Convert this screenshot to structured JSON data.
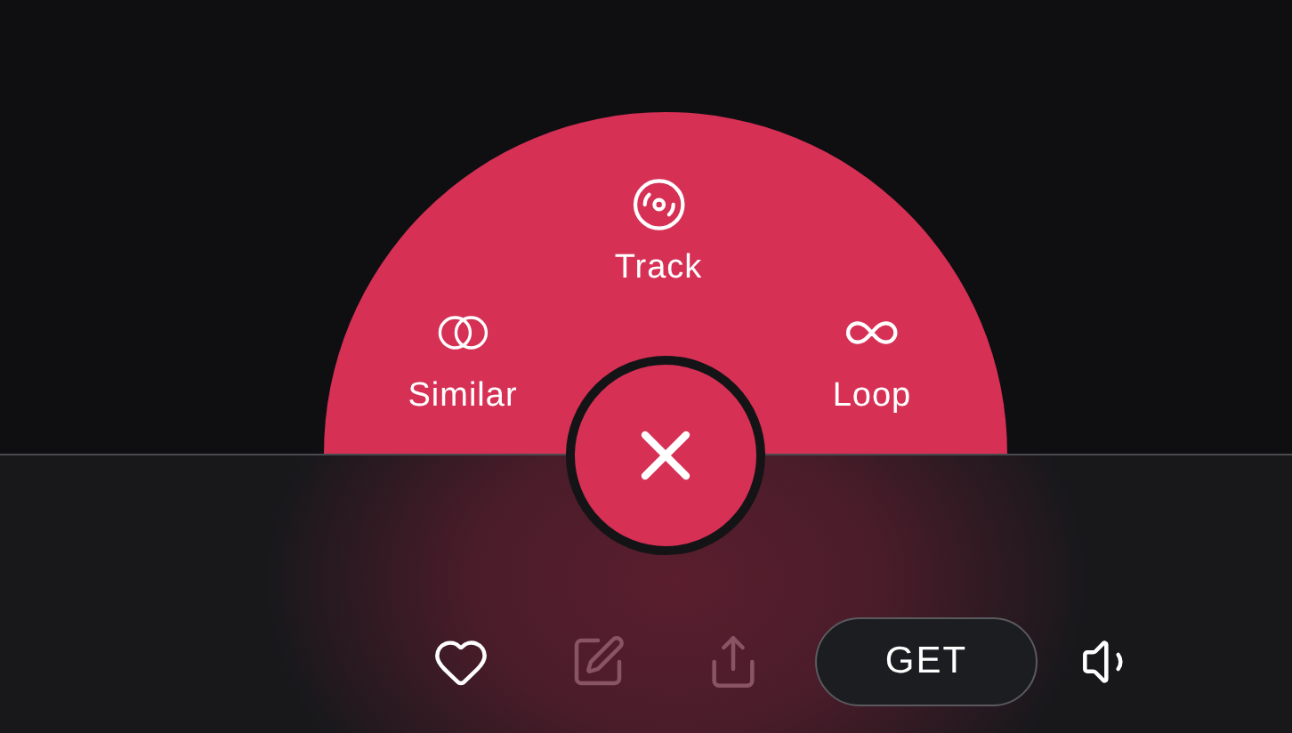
{
  "radial_menu": {
    "actions": [
      {
        "kind": "similar",
        "label": "Similar"
      },
      {
        "kind": "track",
        "label": "Track"
      },
      {
        "kind": "loop",
        "label": "Loop"
      }
    ]
  },
  "toolbar": [
    {
      "kind": "like",
      "disabled": false
    },
    {
      "kind": "edit",
      "disabled": true
    },
    {
      "kind": "share",
      "disabled": true
    },
    {
      "kind": "get",
      "label": "GET"
    },
    {
      "kind": "volume",
      "disabled": false
    }
  ]
}
